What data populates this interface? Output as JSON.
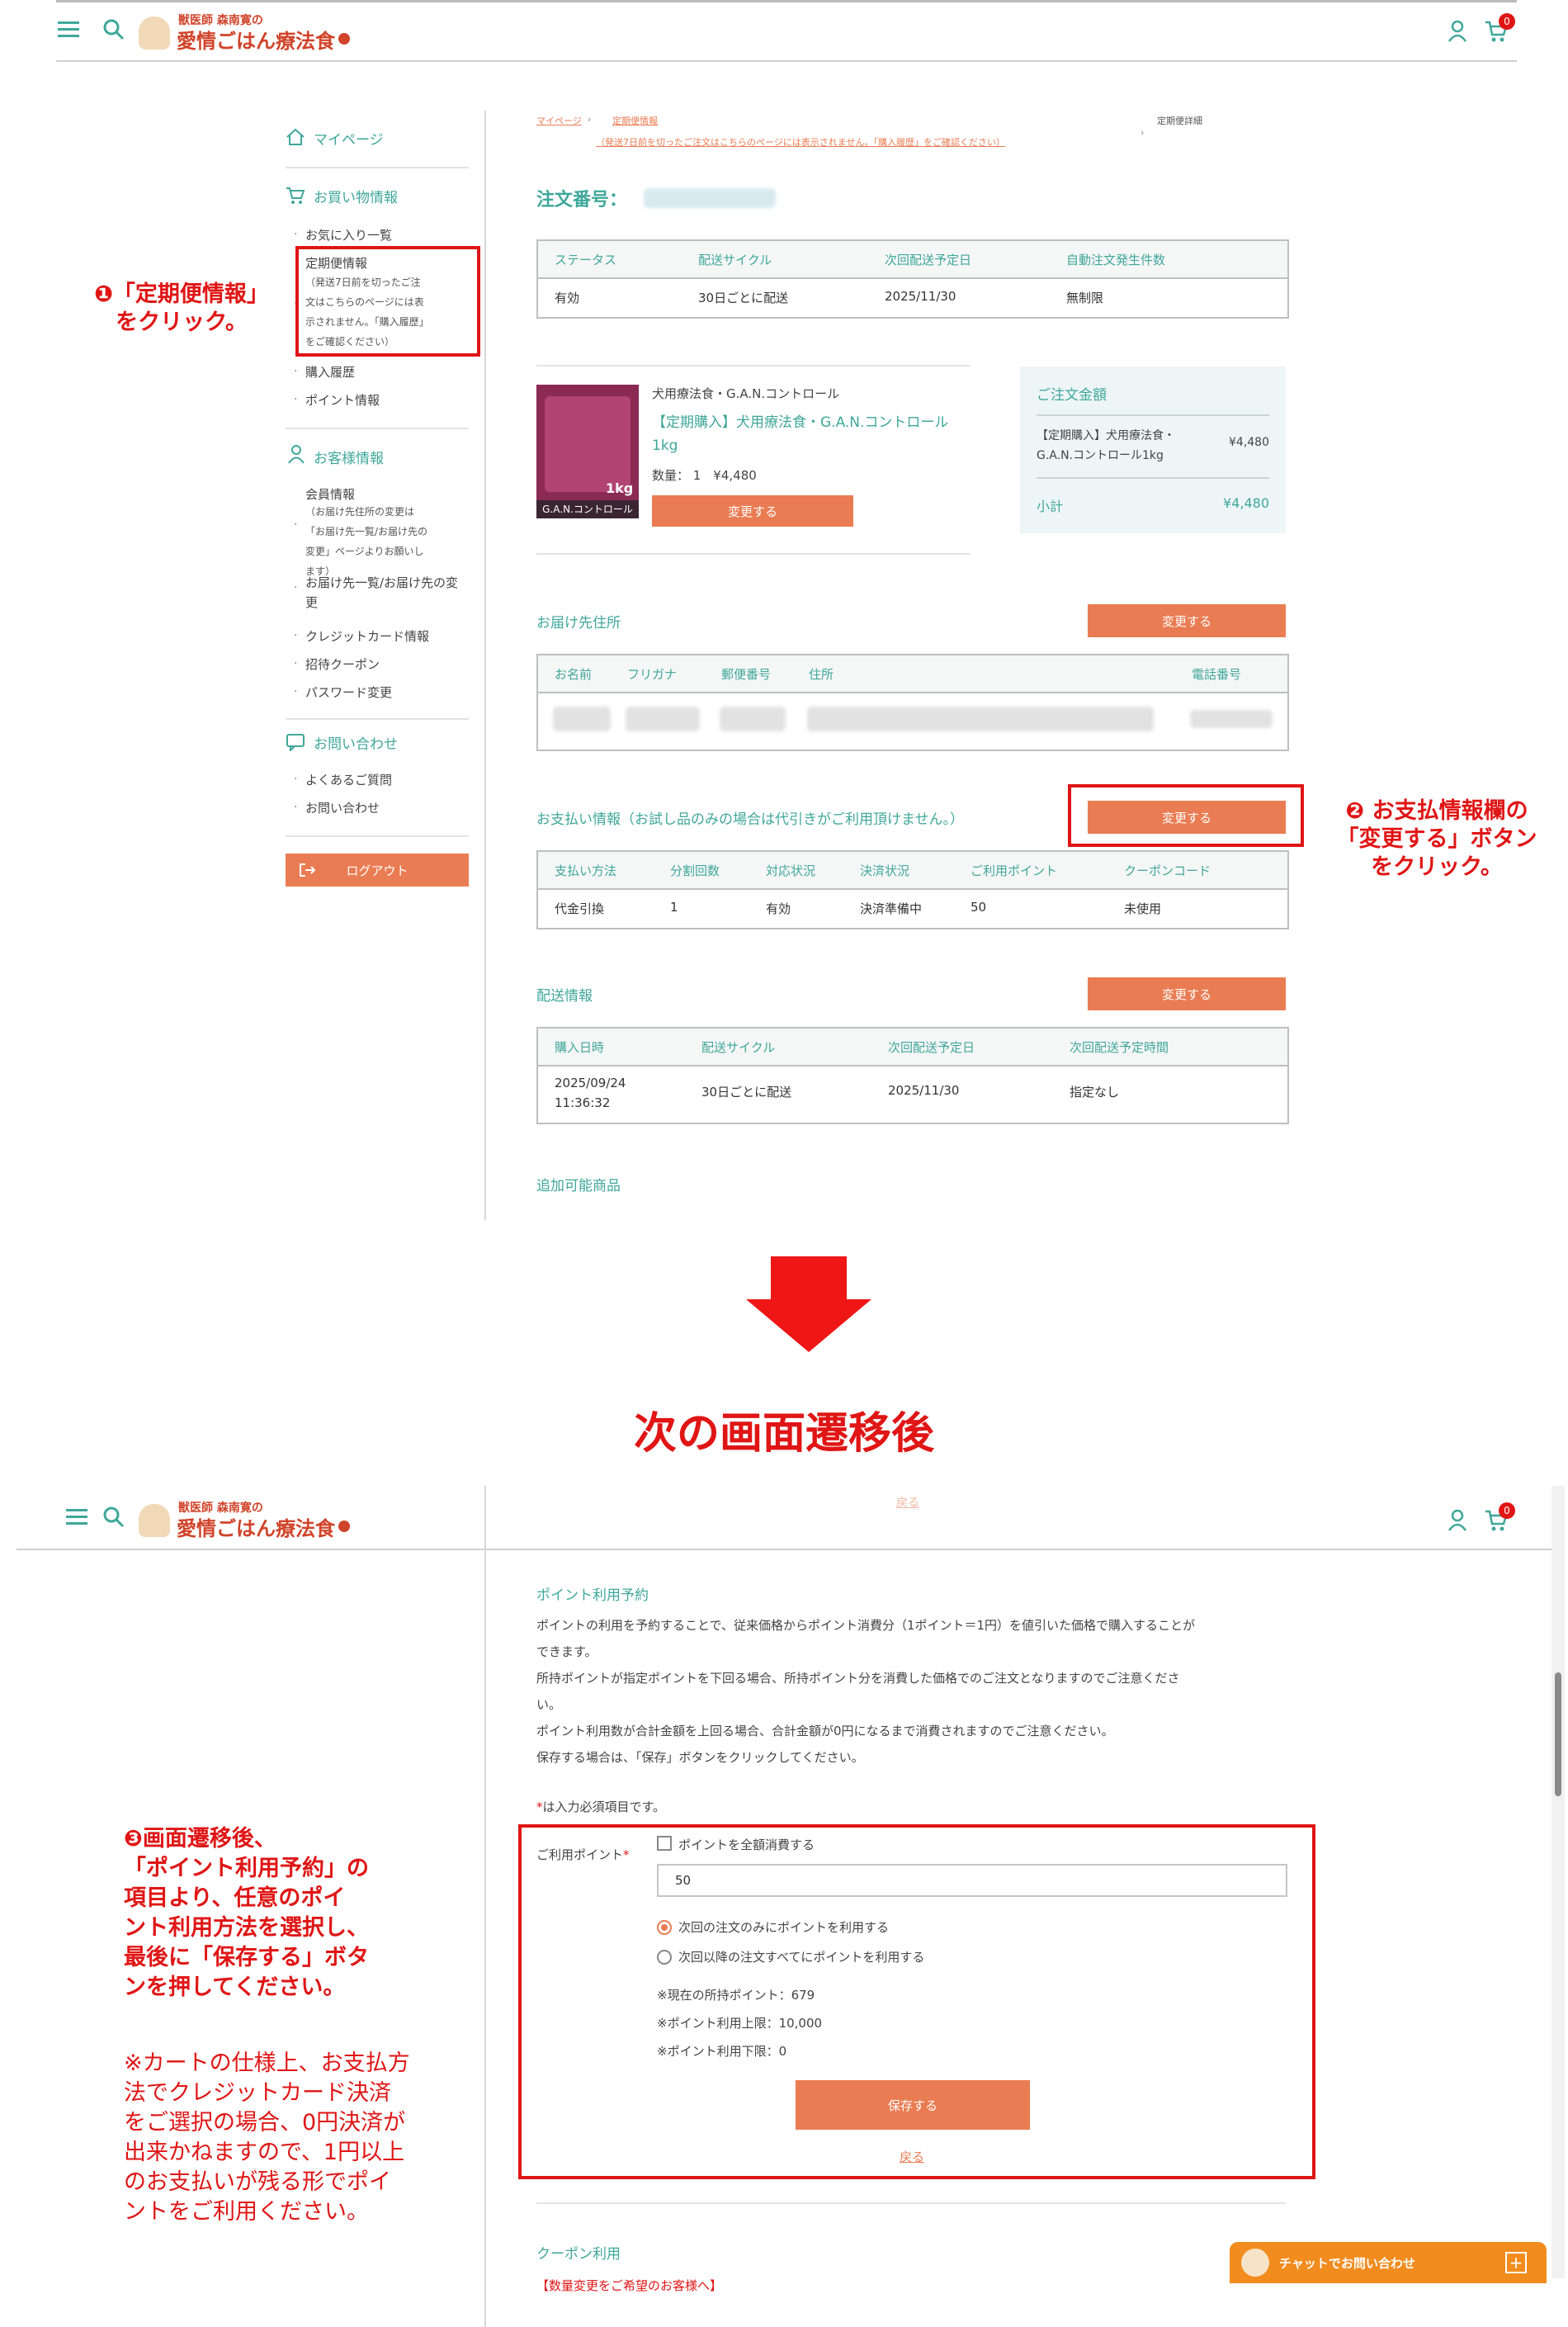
{
  "header": {
    "logo_top": "獣医師 森南寛の",
    "logo_main": "愛情ごはん療法食",
    "cart_count": "0"
  },
  "sidebar": {
    "mypage": "マイページ",
    "shopping_heading": "お買い物情報",
    "favorites": "お気に入り一覧",
    "subscription": "定期便情報",
    "subscription_note": "（発送7日前を切ったご注文はこちらのページには表示されません。「購入履歴」をご確認ください）",
    "purchase_history": "購入履歴",
    "points": "ポイント情報",
    "customer_heading": "お客様情報",
    "member_info": "会員情報",
    "member_note": "（お届け先住所の変更は「お届け先一覧/お届け先の変更」ページよりお願いします）",
    "address_list": "お届け先一覧/お届け先の変更",
    "credit_card": "クレジットカード情報",
    "coupon": "招待クーポン",
    "password": "パスワード変更",
    "inquiry_heading": "お問い合わせ",
    "faq": "よくあるご質問",
    "contact": "お問い合わせ",
    "logout": "ログアウト"
  },
  "breadcrumb": {
    "mypage": "マイページ",
    "subscription": "定期便情報",
    "subscription_note": "（発送7日前を切ったご注文はこちらのページには表示されません。「購入履歴」をご確認ください）",
    "current": "定期便詳細"
  },
  "order": {
    "number_label": "注文番号：",
    "status_table": {
      "headers": [
        "ステータス",
        "配送サイクル",
        "次回配送予定日",
        "自動注文発生件数"
      ],
      "row": [
        "有効",
        "30日ごとに配送",
        "2025/11/30",
        "無制限"
      ]
    },
    "product": {
      "category": "犬用療法食・G.A.N.コントロール",
      "name": "【定期購入】犬用療法食・G.A.N.コントロール1kg",
      "qty_price": "数量： 1　¥4,480",
      "change": "変更する",
      "image_caption": "G.A.N.コントロール",
      "image_size": "1kg"
    },
    "summary": {
      "title": "ご注文金額",
      "item_name": "【定期購入】犬用療法食・G.A.N.コントロール1kg",
      "item_price": "¥4,480",
      "subtotal_label": "小計",
      "subtotal": "¥4,480"
    },
    "delivery": {
      "title": "お届け先住所",
      "change": "変更する",
      "headers": [
        "お名前",
        "フリガナ",
        "郵便番号",
        "住所",
        "電話番号"
      ]
    },
    "payment": {
      "title": "お支払い情報（お試し品のみの場合は代引きがご利用頂けません。）",
      "change": "変更する",
      "headers": [
        "支払い方法",
        "分割回数",
        "対応状況",
        "決済状況",
        "ご利用ポイント",
        "クーポンコード"
      ],
      "row": [
        "代金引換",
        "1",
        "有効",
        "決済準備中",
        "50",
        "未使用"
      ]
    },
    "shipping": {
      "title": "配送情報",
      "change": "変更する",
      "headers": [
        "購入日時",
        "配送サイクル",
        "次回配送予定日",
        "次回配送予定時間"
      ],
      "row": [
        "2025/09/24\n11:36:32",
        "30日ごとに配送",
        "2025/11/30",
        "指定なし"
      ]
    },
    "additional": "追加可能商品"
  },
  "annotations": {
    "step1": "❶「定期便情報」\nをクリック。",
    "step2": "❷ お支払情報欄の\n「変更する」ボタン\nをクリック。",
    "transition": "次の画面遷移後",
    "step3": "❸画面遷移後、\n「ポイント利用予約」の\n項目より、任意のポイ\nント利用方法を選択し、\n最後に「保存する」ボタ\nンを押してください。",
    "note": "※カートの仕様上、お支払方\n法でクレジットカード決済\nをご選択の場合、0円決済が\n出来かねますので、1円以上\nのお支払いが残る形でポイ\nントをご利用ください。"
  },
  "points_page": {
    "top_link": "戻る",
    "title": "ポイント利用予約",
    "desc": [
      "ポイントの利用を予約することで、従来価格からポイント消費分（1ポイント＝1円）を値引いた価格で購入することが",
      "できます。",
      "所持ポイントが指定ポイントを下回る場合、所持ポイント分を消費した価格でのご注文となりますのでご注意くださ",
      "い。",
      "ポイント利用数が合計金額を上回る場合、合計金額が0円になるまで消費されますのでご注意ください。",
      "保存する場合は、「保存」ボタンをクリックしてください。"
    ],
    "required_mark": "*",
    "required_text": "は入力必須項目です。",
    "field_label": "ご利用ポイント",
    "use_all": "ポイントを全額消費する",
    "input_value": "50",
    "radio1": "次回の注文のみにポイントを利用する",
    "radio2": "次回以降の注文すべてにポイントを利用する",
    "current_points": "※現在の所持ポイント：679",
    "max_points": "※ポイント利用上限：10,000",
    "min_points": "※ポイント利用下限：0",
    "save": "保存する",
    "back": "戻る",
    "coupon_title": "クーポン利用",
    "qty_change": "【数量変更をご希望のお客様へ】",
    "chat": "チャットでお問い合わせ"
  }
}
